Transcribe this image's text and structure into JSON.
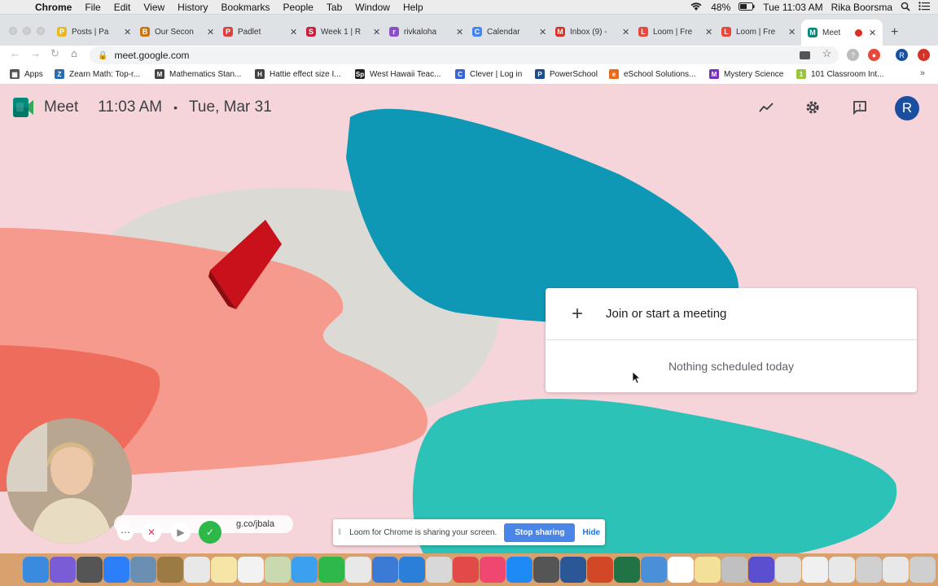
{
  "menubar": {
    "app": "Chrome",
    "items": [
      "File",
      "Edit",
      "View",
      "History",
      "Bookmarks",
      "People",
      "Tab",
      "Window",
      "Help"
    ],
    "battery": "48%",
    "clock": "Tue 11:03 AM",
    "user": "Rika Boorsma"
  },
  "tabs": [
    {
      "title": "Posts | Pa",
      "color": "#e8b923",
      "glyph": "P"
    },
    {
      "title": "Our Secon",
      "color": "#c9740f",
      "glyph": "B"
    },
    {
      "title": "Padlet",
      "color": "#d94040",
      "glyph": "P"
    },
    {
      "title": "Week 1 | R",
      "color": "#cc1f3a",
      "glyph": "S"
    },
    {
      "title": "rivkaloha",
      "color": "#8a4fc7",
      "glyph": "r"
    },
    {
      "title": "Calendar",
      "color": "#4285f4",
      "glyph": "C"
    },
    {
      "title": "Inbox (9) -",
      "color": "#d93025",
      "glyph": "M"
    },
    {
      "title": "Loom | Fre",
      "color": "#e8473a",
      "glyph": "L"
    },
    {
      "title": "Loom | Fre",
      "color": "#e8473a",
      "glyph": "L"
    },
    {
      "title": "Meet",
      "color": "#00897b",
      "glyph": "M"
    }
  ],
  "toolbar": {
    "url": "meet.google.com",
    "profile": "R"
  },
  "bookmarks": [
    {
      "label": "Apps",
      "color": "#555",
      "glyph": "▦"
    },
    {
      "label": "Zearn Math: Top-r...",
      "color": "#2b6cb0",
      "glyph": "Z"
    },
    {
      "label": "Mathematics Stan...",
      "color": "#444",
      "glyph": "M"
    },
    {
      "label": "Hattie effect size I...",
      "color": "#444",
      "glyph": "H"
    },
    {
      "label": "West Hawaii Teac...",
      "color": "#222",
      "glyph": "Sp"
    },
    {
      "label": "Clever | Log in",
      "color": "#3764d9",
      "glyph": "C"
    },
    {
      "label": "PowerSchool",
      "color": "#1f4e8c",
      "glyph": "P"
    },
    {
      "label": "eSchool Solutions...",
      "color": "#e86a1a",
      "glyph": "e"
    },
    {
      "label": "Mystery Science",
      "color": "#7a2fbf",
      "glyph": "M"
    },
    {
      "label": "101 Classroom Int...",
      "color": "#9bc53d",
      "glyph": "1"
    }
  ],
  "meet": {
    "brand": "Meet",
    "time": "11:03 AM",
    "date": "Tue, Mar 31",
    "avatar": "R",
    "join_label": "Join or start a meeting",
    "empty_label": "Nothing scheduled today"
  },
  "loom": {
    "link": "g.co/jbala",
    "share_text": "Loom for Chrome is sharing your screen.",
    "stop_label": "Stop sharing",
    "hide_label": "Hide"
  },
  "dock": [
    "#3a8be0",
    "#7a5cd6",
    "#555",
    "#2d7ff9",
    "#6b8fb3",
    "#9c7a44",
    "#e8e8e8",
    "#f5e6a8",
    "#f2f2f2",
    "#c9d9b0",
    "#3ca0f0",
    "#2fb84a",
    "#e8e8e8",
    "#3b7bd6",
    "#2a7fd9",
    "#d8d8d8",
    "#e24a4a",
    "#f04770",
    "#1d8af5",
    "#555",
    "#2b5797",
    "#d24726",
    "#217346",
    "#4a90d9",
    "#ffffff",
    "#f3e19a",
    "#c0c0c0",
    "#5a4fcf",
    "#e0e0e0",
    "#f0f0f0",
    "#e8e8e8",
    "#d0d0d0",
    "#e8e8e8",
    "#cfcfcf"
  ]
}
